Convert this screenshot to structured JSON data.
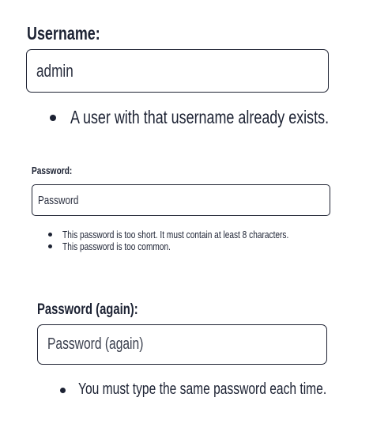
{
  "username": {
    "label": "Username:",
    "value": "admin",
    "errors": [
      "A user with that username already exists."
    ]
  },
  "password": {
    "label": "Password:",
    "placeholder": "Password",
    "value": "",
    "errors": [
      "This password is too short. It must contain at least 8 characters.",
      "This password is too common."
    ]
  },
  "password_again": {
    "label": "Password (again):",
    "placeholder": "Password (again)",
    "value": "",
    "errors": [
      "You must type the same password each time."
    ]
  }
}
